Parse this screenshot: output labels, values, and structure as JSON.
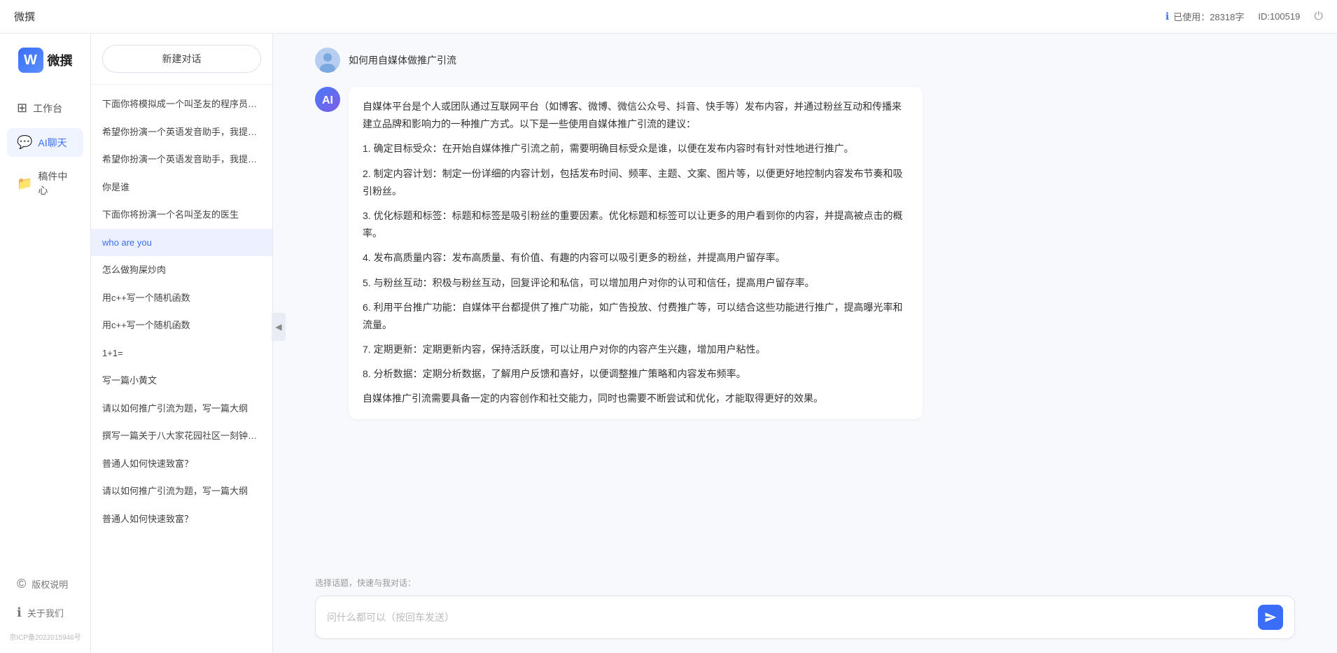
{
  "topbar": {
    "title": "微撰",
    "usage_label": "已使用：28318字",
    "id_label": "ID:100519",
    "info_icon": "ℹ"
  },
  "logo": {
    "letter": "W",
    "text": "微撰"
  },
  "nav": {
    "items": [
      {
        "id": "workbench",
        "icon": "⊞",
        "label": "工作台"
      },
      {
        "id": "ai-chat",
        "icon": "💬",
        "label": "AI聊天",
        "active": true
      },
      {
        "id": "drafts",
        "icon": "📁",
        "label": "稿件中心"
      }
    ],
    "bottom_items": [
      {
        "id": "copyright",
        "icon": "©",
        "label": "版权说明"
      },
      {
        "id": "about",
        "icon": "ℹ",
        "label": "关于我们"
      }
    ],
    "icp": "京ICP备2022015946号"
  },
  "sidebar": {
    "new_chat_label": "新建对话",
    "items": [
      {
        "text": "下面你将模拟成一个叫圣友的程序员，我说...",
        "active": false
      },
      {
        "text": "希望你扮演一个英语发音助手，我提供给你...",
        "active": false
      },
      {
        "text": "希望你扮演一个英语发音助手，我提供给你...",
        "active": false
      },
      {
        "text": "你是谁",
        "active": false
      },
      {
        "text": "下面你将扮演一个名叫圣友的医生",
        "active": false
      },
      {
        "text": "who are you",
        "active": true
      },
      {
        "text": "怎么做狗屎炒肉",
        "active": false
      },
      {
        "text": "用c++写一个随机函数",
        "active": false
      },
      {
        "text": "用c++写一个随机函数",
        "active": false
      },
      {
        "text": "1+1=",
        "active": false
      },
      {
        "text": "写一篇小黄文",
        "active": false
      },
      {
        "text": "请以如何推广引流为题，写一篇大纲",
        "active": false
      },
      {
        "text": "撰写一篇关于八大家花园社区一刻钟便民生...",
        "active": false
      },
      {
        "text": "普通人如何快速致富？",
        "active": false
      },
      {
        "text": "请以如何推广引流为题，写一篇大纲",
        "active": false
      },
      {
        "text": "普通人如何快速致富？",
        "active": false
      }
    ]
  },
  "chat": {
    "user_question": "如何用自媒体做推广引流",
    "ai_response_paragraphs": [
      "自媒体平台是个人或团队通过互联网平台（如博客、微博、微信公众号、抖音、快手等）发布内容，并通过粉丝互动和传播来建立品牌和影响力的一种推广方式。以下是一些使用自媒体推广引流的建议：",
      "1. 确定目标受众：在开始自媒体推广引流之前，需要明确目标受众是谁，以便在发布内容时有针对性地进行推广。",
      "2. 制定内容计划：制定一份详细的内容计划，包括发布时间、频率、主题、文案、图片等，以便更好地控制内容发布节奏和吸引粉丝。",
      "3. 优化标题和标签：标题和标签是吸引粉丝的重要因素。优化标题和标签可以让更多的用户看到你的内容，并提高被点击的概率。",
      "4. 发布高质量内容：发布高质量、有价值、有趣的内容可以吸引更多的粉丝，并提高用户留存率。",
      "5. 与粉丝互动：积极与粉丝互动，回复评论和私信，可以增加用户对你的认可和信任，提高用户留存率。",
      "6. 利用平台推广功能：自媒体平台都提供了推广功能，如广告投放、付费推广等，可以结合这些功能进行推广，提高曝光率和流量。",
      "7. 定期更新：定期更新内容，保持活跃度，可以让用户对你的内容产生兴趣，增加用户粘性。",
      "8. 分析数据：定期分析数据，了解用户反馈和喜好，以便调整推广策略和内容发布频率。",
      "自媒体推广引流需要具备一定的内容创作和社交能力，同时也需要不断尝试和优化，才能取得更好的效果。"
    ],
    "quick_topics_label": "选择话题，快速与我对话：",
    "input_placeholder": "问什么都可以（按回车发送）"
  }
}
